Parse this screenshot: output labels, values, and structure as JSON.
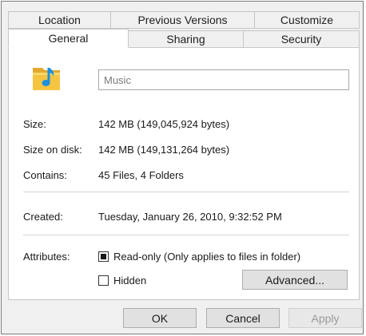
{
  "tabs_row1": [
    {
      "label": "Location"
    },
    {
      "label": "Previous Versions"
    },
    {
      "label": "Customize"
    }
  ],
  "tabs_row2": [
    {
      "label": "General",
      "active": true
    },
    {
      "label": "Sharing"
    },
    {
      "label": "Security"
    }
  ],
  "general": {
    "folder_name": "Music",
    "icon": "music-folder-icon",
    "size_label": "Size:",
    "size_value": "142 MB (149,045,924 bytes)",
    "size_on_disk_label": "Size on disk:",
    "size_on_disk_value": "142 MB (149,131,264 bytes)",
    "contains_label": "Contains:",
    "contains_value": "45 Files, 4 Folders",
    "created_label": "Created:",
    "created_value": "Tuesday, January 26, 2010, 9:32:52 PM",
    "attributes_label": "Attributes:",
    "readonly_label": "Read-only (Only applies to files in folder)",
    "readonly_state": "indeterminate",
    "hidden_label": "Hidden",
    "hidden_state": "unchecked",
    "advanced_label": "Advanced..."
  },
  "footer": {
    "ok_label": "OK",
    "cancel_label": "Cancel",
    "apply_label": "Apply",
    "apply_enabled": false
  },
  "colors": {
    "dialog_bg": "#f0f0f0",
    "panel_bg": "#ffffff",
    "folder_yellow": "#f5c542",
    "music_note_blue": "#1c8fe0"
  }
}
